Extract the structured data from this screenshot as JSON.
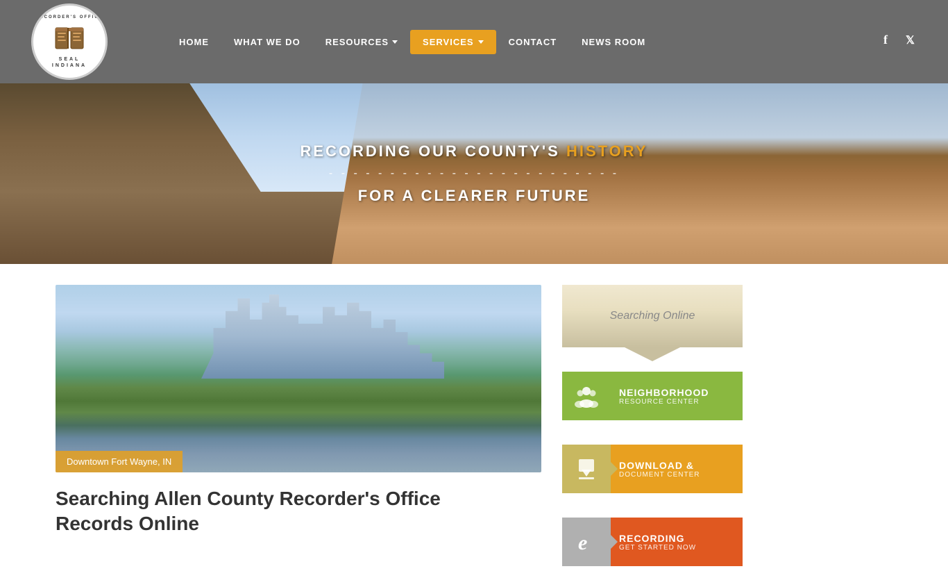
{
  "header": {
    "logo_top_text": "RECORDER'S OFFICE",
    "logo_bottom_text": "INDIANA",
    "logo_seal_text": "SEAL"
  },
  "nav": {
    "items": [
      {
        "id": "home",
        "label": "HOME",
        "active": false,
        "has_chevron": false
      },
      {
        "id": "what-we-do",
        "label": "WHAT WE DO",
        "active": false,
        "has_chevron": false
      },
      {
        "id": "resources",
        "label": "RESOURCES",
        "active": false,
        "has_chevron": true
      },
      {
        "id": "services",
        "label": "SERVICES",
        "active": true,
        "has_chevron": true
      },
      {
        "id": "contact",
        "label": "CONTACT",
        "active": false,
        "has_chevron": false
      },
      {
        "id": "news-room",
        "label": "NEWS ROOM",
        "active": false,
        "has_chevron": false
      }
    ]
  },
  "hero": {
    "line1_prefix": "RECORDING OUR COUNTY'S ",
    "line1_highlight": "HISTORY",
    "divider": "- - - - - - - - - - - - - - - - - - - - - - - -",
    "line2": "FOR A CLEARER FUTURE"
  },
  "main": {
    "featured_image_caption": "Downtown Fort Wayne, IN",
    "article_title_line1": "Searching Allen County Recorder's Office",
    "article_title_line2": "Records Online"
  },
  "sidebar": {
    "searching_online_label": "Searching Online",
    "cards": [
      {
        "id": "neighborhood",
        "icon": "people",
        "title": "NEIGHBORHOOD",
        "subtitle": "RESOURCE CENTER"
      },
      {
        "id": "download",
        "icon": "download",
        "title": "DOWNLOAD &",
        "subtitle": "DOCUMENT CENTER"
      },
      {
        "id": "recording",
        "icon": "e",
        "title": "RECORDING",
        "subtitle": "GET STARTED NOW"
      }
    ]
  },
  "social": {
    "facebook_label": "f",
    "twitter_label": "t"
  }
}
